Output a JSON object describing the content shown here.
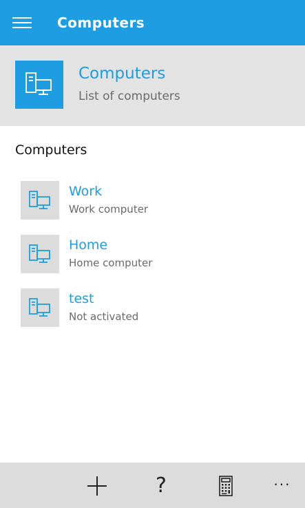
{
  "colors": {
    "accent": "#1e9de2",
    "header_band": "#e3e3e3",
    "tile_gray": "#dcdcdc",
    "appbar": "#dcdcdc"
  },
  "titlebar": {
    "menu_icon": "hamburger-icon",
    "title": "Computers"
  },
  "header": {
    "icon": "computer-icon",
    "title": "Computers",
    "subtitle": "List of computers"
  },
  "section": {
    "heading": "Computers"
  },
  "computers": [
    {
      "name": "Work",
      "description": "Work computer",
      "icon": "computer-icon"
    },
    {
      "name": "Home",
      "description": "Home computer",
      "icon": "computer-icon"
    },
    {
      "name": "test",
      "description": "Not activated",
      "icon": "computer-icon"
    }
  ],
  "appbar": {
    "buttons": [
      {
        "icon": "add-icon"
      },
      {
        "icon": "help-icon",
        "glyph": "?"
      },
      {
        "icon": "calculator-icon"
      },
      {
        "icon": "more-icon",
        "glyph": "···"
      }
    ]
  }
}
